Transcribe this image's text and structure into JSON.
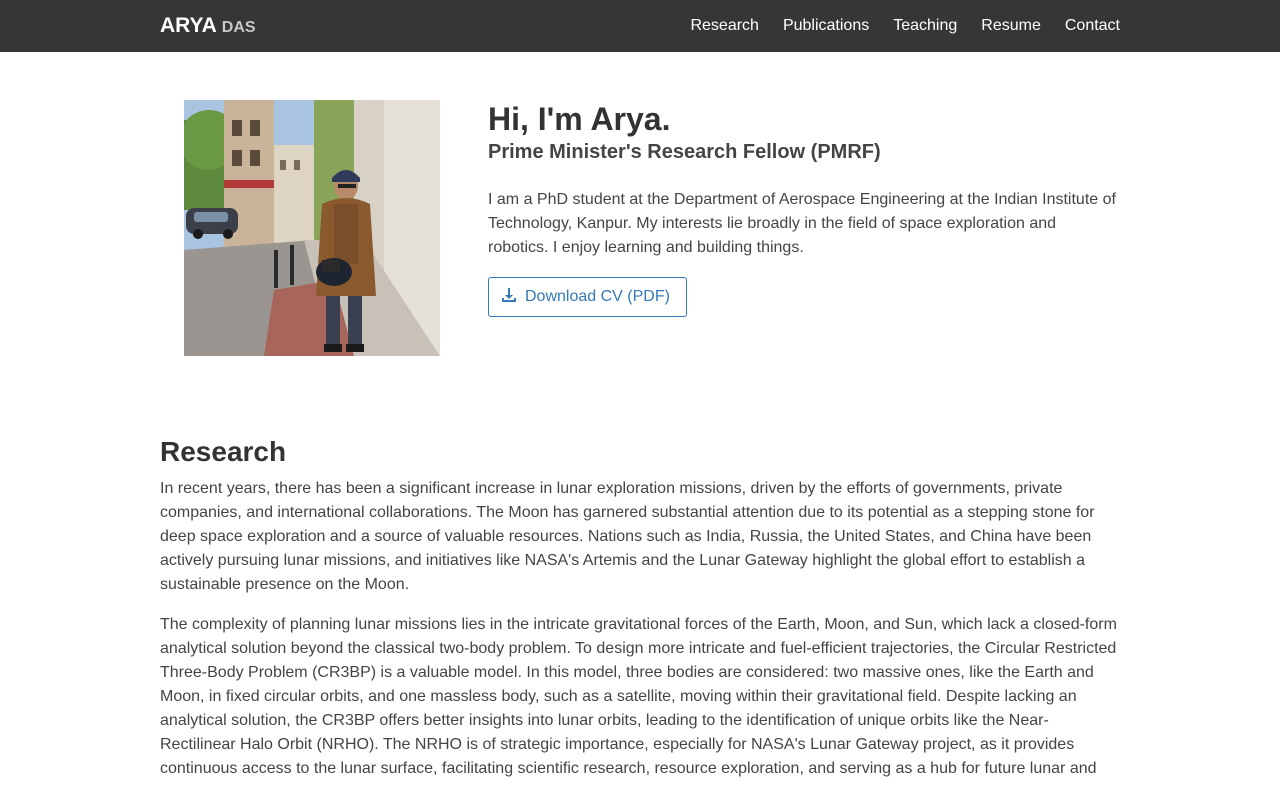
{
  "navbar": {
    "brand_first": "ARYA",
    "brand_last": "DAS",
    "links": [
      "Research",
      "Publications",
      "Teaching",
      "Resume",
      "Contact"
    ]
  },
  "hero": {
    "title": "Hi, I'm Arya.",
    "subtitle": "Prime Minister's Research Fellow (PMRF)",
    "bio": "I am a PhD student at the Department of Aerospace Engineering at the Indian Institute of Technology, Kanpur. My interests lie broadly in the field of space exploration and robotics. I enjoy learning and building things.",
    "cv_button_label": "Download CV (PDF)",
    "cv_icon": "download-icon"
  },
  "research": {
    "title": "Research",
    "paragraphs": [
      "In recent years, there has been a significant increase in lunar exploration missions, driven by the efforts of governments, private companies, and international collaborations. The Moon has garnered substantial attention due to its potential as a stepping stone for deep space exploration and a source of valuable resources. Nations such as India, Russia, the United States, and China have been actively pursuing lunar missions, and initiatives like NASA's Artemis and the Lunar Gateway highlight the global effort to establish a sustainable presence on the Moon.",
      "The complexity of planning lunar missions lies in the intricate gravitational forces of the Earth, Moon, and Sun, which lack a closed-form analytical solution beyond the classical two-body problem. To design more intricate and fuel-efficient trajectories, the Circular Restricted Three-Body Problem (CR3BP) is a valuable model. In this model, three bodies are considered: two massive ones, like the Earth and Moon, in fixed circular orbits, and one massless body, such as a satellite, moving within their gravitational field. Despite lacking an analytical solution, the CR3BP offers better insights into lunar orbits, leading to the identification of unique orbits like the Near-Rectilinear Halo Orbit (NRHO). The NRHO is of strategic importance, especially for NASA's Lunar Gateway project, as it provides continuous access to the lunar surface, facilitating scientific research, resource exploration, and serving as a hub for future lunar and"
    ]
  },
  "colors": {
    "navbar_bg": "#363636",
    "accent": "#337ab7",
    "text": "#333333"
  }
}
